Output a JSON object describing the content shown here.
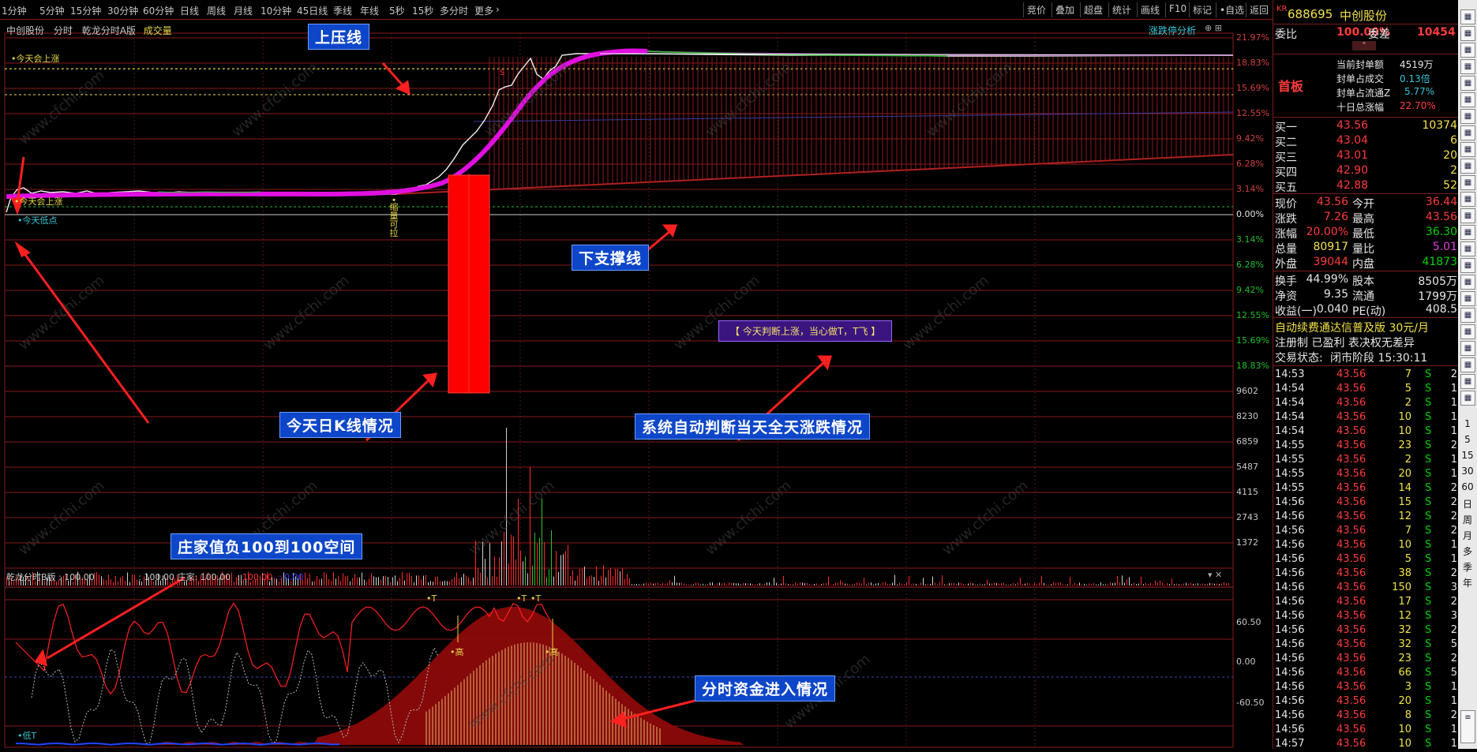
{
  "toolbar": {
    "periods": [
      "1分钟",
      "5分钟",
      "15分钟",
      "30分钟",
      "60分钟",
      "日线",
      "周线",
      "月线",
      "10分钟",
      "45日线",
      "季线",
      "年线",
      "5秒",
      "15秒",
      "多分时",
      "更多"
    ],
    "right_buttons": [
      "竞价",
      "叠加",
      "超盘",
      "统计",
      "画线",
      "F10",
      "标记",
      "•自选",
      "返回"
    ]
  },
  "chart": {
    "header_left": [
      "中创股份",
      "分时",
      "乾龙分时A版",
      "成交量"
    ],
    "header_right_btn": "涨跌停分析",
    "right_axis_pct": [
      "21.97%",
      "18.83%",
      "15.69%",
      "12.55%",
      "9.42%",
      "6.28%",
      "3.14%",
      "0.00%",
      "3.14%",
      "6.28%",
      "9.42%",
      "12.55%",
      "15.69%",
      "18.83%"
    ],
    "right_axis_vol": [
      "9602",
      "8230",
      "6859",
      "5487",
      "4115",
      "2743",
      "1372"
    ],
    "right_axis_ind": [
      "60.50",
      "0.00",
      "-60.50"
    ],
    "labels": {
      "today_will_rise_1": "•今天会上涨",
      "today_will_rise_2": "•今天会上涨",
      "today_low": "•今天低点",
      "pullup": "•缩量可拉",
      "t_label1": "•T",
      "t_label2": "•T",
      "t_label3": "•T",
      "gao1": "•高",
      "gao2": "•高",
      "low_t": "•低T",
      "small_s": "S"
    },
    "indicator_header": [
      "乾龙分时B版 : 100.00",
      ": 100.00 庄家: 100.00",
      ": 100.00",
      ": 0.00"
    ],
    "annotations": {
      "upper": "上压线",
      "lower": "下支撑线",
      "kline": "今天日K线情况",
      "auto": "系统自动判断当天全天涨跌情况",
      "banker": "庄家值负100到100空间",
      "fund": "分时资金进入情况"
    },
    "purple_message": "【 今天判断上涨，当心做T，T飞 】",
    "watermark": "www.cfchi.com",
    "colors": {
      "price_line": "#ffffff",
      "avg_line": "#e040e0",
      "grid": "#8a1a1a",
      "kline": "#ff0000",
      "annot_bg": "#0d46c9"
    }
  },
  "quote": {
    "code_prefix": "KR",
    "code": "688695",
    "name": "中创股份",
    "weibi_label": "委比",
    "weibi": "100.00%",
    "weicha_label": "委差",
    "weicha": "10454",
    "shouban": "首板",
    "seal_info": [
      {
        "label": "当前封单额",
        "value": "4519万"
      },
      {
        "label": "封单占成交",
        "value": "0.13倍"
      },
      {
        "label": "封单占流通Z",
        "value": "5.77%"
      },
      {
        "label": "十日总涨幅",
        "value": "22.70%"
      }
    ],
    "bids": [
      {
        "label": "买一",
        "price": "43.56",
        "vol": "10374"
      },
      {
        "label": "买二",
        "price": "43.04",
        "vol": "6"
      },
      {
        "label": "买三",
        "price": "43.01",
        "vol": "20"
      },
      {
        "label": "买四",
        "price": "42.90",
        "vol": "2"
      },
      {
        "label": "买五",
        "price": "42.88",
        "vol": "52"
      }
    ],
    "stats": [
      {
        "l1": "现价",
        "v1": "43.56",
        "l2": "今开",
        "v2": "36.44"
      },
      {
        "l1": "涨跌",
        "v1": "7.26",
        "l2": "最高",
        "v2": "43.56"
      },
      {
        "l1": "涨幅",
        "v1": "20.00%",
        "l2": "最低",
        "v2": "36.30"
      },
      {
        "l1": "总量",
        "v1": "80917",
        "l2": "量比",
        "v2": "5.01"
      },
      {
        "l1": "外盘",
        "v1": "39044",
        "l2": "内盘",
        "v2": "41873"
      }
    ],
    "stats2": [
      {
        "l1": "换手",
        "v1": "44.99%",
        "l2": "股本",
        "v2": "8505万"
      },
      {
        "l1": "净资",
        "v1": "9.35",
        "l2": "流通",
        "v2": "1799万"
      },
      {
        "l1": "收益(一)",
        "v1": "0.040",
        "l2": "PE(动)",
        "v2": "408.5"
      }
    ],
    "ad_line1": "自动续费通达信普及版  30元/月",
    "ad_line2": "注册制 已盈利 表决权无差异",
    "status_label": "交易状态:",
    "status_value": "闭市阶段 15:30:11",
    "ticks": [
      [
        "14:53",
        "43.56",
        "7",
        "S",
        "2"
      ],
      [
        "14:54",
        "43.56",
        "5",
        "S",
        "1"
      ],
      [
        "14:54",
        "43.56",
        "2",
        "S",
        "1"
      ],
      [
        "14:54",
        "43.56",
        "10",
        "S",
        "1"
      ],
      [
        "14:54",
        "43.56",
        "10",
        "S",
        "1"
      ],
      [
        "14:55",
        "43.56",
        "23",
        "S",
        "2"
      ],
      [
        "14:55",
        "43.56",
        "2",
        "S",
        "1"
      ],
      [
        "14:55",
        "43.56",
        "20",
        "S",
        "1"
      ],
      [
        "14:55",
        "43.56",
        "14",
        "S",
        "2"
      ],
      [
        "14:56",
        "43.56",
        "15",
        "S",
        "2"
      ],
      [
        "14:56",
        "43.56",
        "12",
        "S",
        "2"
      ],
      [
        "14:56",
        "43.56",
        "7",
        "S",
        "2"
      ],
      [
        "14:56",
        "43.56",
        "10",
        "S",
        "1"
      ],
      [
        "14:56",
        "43.56",
        "5",
        "S",
        "1"
      ],
      [
        "14:56",
        "43.56",
        "38",
        "S",
        "2"
      ],
      [
        "14:56",
        "43.56",
        "150",
        "S",
        "3"
      ],
      [
        "14:56",
        "43.56",
        "17",
        "S",
        "2"
      ],
      [
        "14:56",
        "43.56",
        "12",
        "S",
        "3"
      ],
      [
        "14:56",
        "43.56",
        "32",
        "S",
        "2"
      ],
      [
        "14:56",
        "43.56",
        "32",
        "S",
        "5"
      ],
      [
        "14:56",
        "43.56",
        "23",
        "S",
        "2"
      ],
      [
        "14:56",
        "43.56",
        "66",
        "S",
        "5"
      ],
      [
        "14:56",
        "43.56",
        "3",
        "S",
        "1"
      ],
      [
        "14:56",
        "43.56",
        "20",
        "S",
        "1"
      ],
      [
        "14:56",
        "43.56",
        "8",
        "S",
        "2"
      ],
      [
        "14:56",
        "43.56",
        "10",
        "S",
        "1"
      ],
      [
        "14:57",
        "43.56",
        "10",
        "S",
        "1"
      ]
    ]
  },
  "side_icons": {
    "text_items": [
      "1",
      "5",
      "15",
      "30",
      "60",
      "日",
      "周",
      "月",
      "多",
      "季",
      "年"
    ]
  }
}
